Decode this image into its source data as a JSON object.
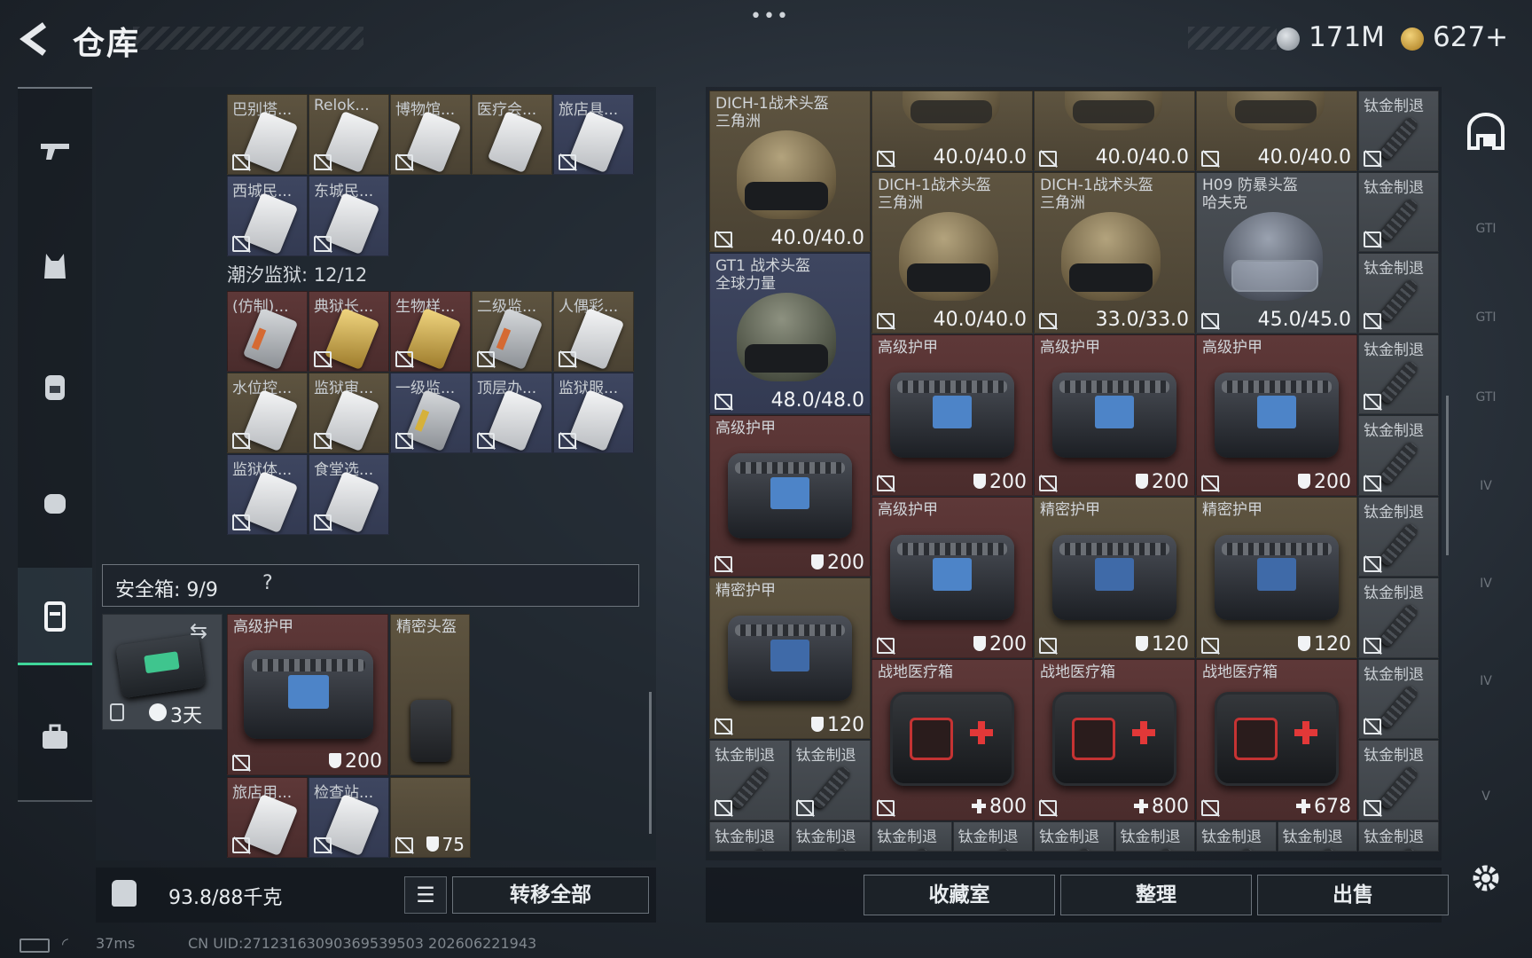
{
  "header": {
    "back_glyph": "<",
    "title": "仓库",
    "menu_dots": "•••"
  },
  "currency": {
    "silver": "171M",
    "gold": "627+"
  },
  "left_nav": [
    {
      "name": "firearms-tab",
      "icon": "gun-icon"
    },
    {
      "name": "gear-tab",
      "icon": "vest-icon"
    },
    {
      "name": "backpack-tab",
      "icon": "backpack-icon"
    },
    {
      "name": "rig-tab",
      "icon": "rig-icon"
    },
    {
      "name": "container-tab",
      "icon": "container-icon",
      "active": true
    },
    {
      "name": "briefcase-tab",
      "icon": "briefcase-icon"
    }
  ],
  "keycards_top": [
    "巴别塔...",
    "Relok...",
    "博物馆...",
    "医疗会...",
    "旅店具...",
    "西城民...",
    "东城民..."
  ],
  "tide_prison": {
    "label": "潮汐监狱: 12/12"
  },
  "keycards_prison": [
    "(仿制)...",
    "典狱长...",
    "生物样...",
    "二级监...",
    "人偶彩...",
    "水位控...",
    "监狱审...",
    "一级监...",
    "顶层办...",
    "监狱服...",
    "监狱体...",
    "食堂选..."
  ],
  "safe_box": {
    "label": "安全箱:  9/9",
    "help": "?",
    "days": "3天",
    "swap_glyph": "⇆"
  },
  "safe_items": {
    "armor": {
      "name": "高级护甲",
      "value": "200"
    },
    "helmet": {
      "name": "精密头盔",
      "value": "75"
    },
    "card1": "旅店用...",
    "card2": "检查站..."
  },
  "left_footer": {
    "weight": "93.8/88千克",
    "move_all": "转移全部",
    "list_glyph": "☰"
  },
  "right_grid": {
    "helmets": [
      {
        "name": "DICH-1战术头盔",
        "sub": "三角洲",
        "dur": "40.0/40.0"
      },
      {
        "name": "",
        "sub": "",
        "dur": "40.0/40.0"
      },
      {
        "name": "",
        "sub": "",
        "dur": "40.0/40.0"
      },
      {
        "name": "",
        "sub": "",
        "dur": "40.0/40.0"
      },
      {
        "name": "DICH-1战术头盔",
        "sub": "三角洲",
        "dur": "40.0/40.0"
      },
      {
        "name": "DICH-1战术头盔",
        "sub": "三角洲",
        "dur": "33.0/33.0"
      },
      {
        "name": "H09 防暴头盔",
        "sub": "哈夫克",
        "dur": "45.0/45.0"
      },
      {
        "name": "GT1 战术头盔",
        "sub": "全球力量",
        "dur": "48.0/48.0"
      }
    ],
    "armors": [
      {
        "name": "高级护甲",
        "value": "200"
      },
      {
        "name": "高级护甲",
        "value": "200"
      },
      {
        "name": "高级护甲",
        "value": "200"
      },
      {
        "name": "高级护甲",
        "value": "200"
      },
      {
        "name": "高级护甲",
        "value": "200"
      },
      {
        "name": "精密护甲",
        "value": "120"
      },
      {
        "name": "精密护甲",
        "value": "120"
      },
      {
        "name": "精密护甲",
        "value": "120"
      }
    ],
    "medkits": [
      {
        "name": "战地医疗箱",
        "value": "800"
      },
      {
        "name": "战地医疗箱",
        "value": "800"
      },
      {
        "name": "战地医疗箱",
        "value": "678"
      }
    ],
    "muzzle_name": "钛金制退"
  },
  "right_footer": {
    "collection": "收藏室",
    "sort": "整理",
    "sell": "出售"
  },
  "right_nav": [
    "GTI",
    "GTI",
    "GTI",
    "IV",
    "IV",
    "IV",
    "V"
  ],
  "status": {
    "ping": "37ms",
    "uid": "CN UID:271231630903695395​03 202606221943"
  },
  "colors": {
    "accent": "#3fd69a",
    "gold_card": "#c7a84a",
    "red_cell": "#5e3838",
    "blue_cell": "#3e4660"
  }
}
